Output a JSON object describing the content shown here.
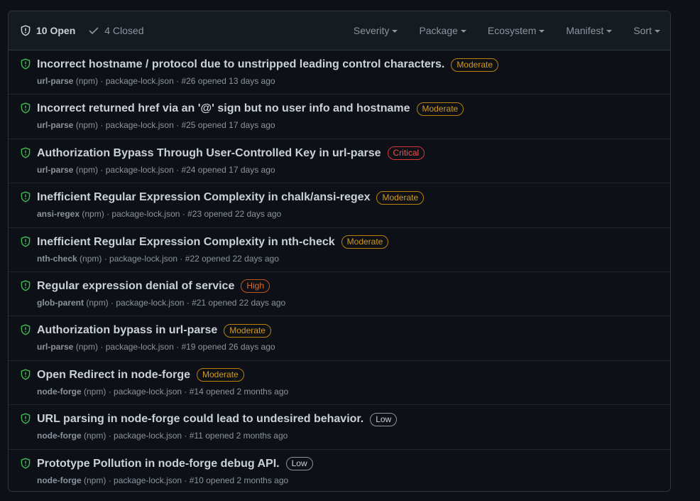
{
  "header": {
    "open_label": "10 Open",
    "closed_label": "4 Closed",
    "filters": [
      "Severity",
      "Package",
      "Ecosystem",
      "Manifest",
      "Sort"
    ]
  },
  "colors": {
    "shield_icon": "#3fb950",
    "moderate": "#d29922",
    "critical": "#f85149",
    "high": "#db6d28",
    "low": "#c9d1d9"
  },
  "alerts": [
    {
      "title": "Incorrect hostname / protocol due to unstripped leading control characters.",
      "severity": "Moderate",
      "severity_key": "moderate",
      "package": "url-parse",
      "ecosystem": "(npm)",
      "details": "· package-lock.json · #26 opened 13 days ago"
    },
    {
      "title": "Incorrect returned href via an '@' sign but no user info and hostname",
      "severity": "Moderate",
      "severity_key": "moderate",
      "package": "url-parse",
      "ecosystem": "(npm)",
      "details": "· package-lock.json · #25 opened 17 days ago"
    },
    {
      "title": "Authorization Bypass Through User-Controlled Key in url-parse",
      "severity": "Critical",
      "severity_key": "critical",
      "package": "url-parse",
      "ecosystem": "(npm)",
      "details": "· package-lock.json · #24 opened 17 days ago"
    },
    {
      "title": "Inefficient Regular Expression Complexity in chalk/ansi-regex",
      "severity": "Moderate",
      "severity_key": "moderate",
      "package": "ansi-regex",
      "ecosystem": "(npm)",
      "details": "· package-lock.json · #23 opened 22 days ago"
    },
    {
      "title": "Inefficient Regular Expression Complexity in nth-check",
      "severity": "Moderate",
      "severity_key": "moderate",
      "package": "nth-check",
      "ecosystem": "(npm)",
      "details": "· package-lock.json · #22 opened 22 days ago"
    },
    {
      "title": "Regular expression denial of service",
      "severity": "High",
      "severity_key": "high",
      "package": "glob-parent",
      "ecosystem": "(npm)",
      "details": "· package-lock.json · #21 opened 22 days ago"
    },
    {
      "title": "Authorization bypass in url-parse",
      "severity": "Moderate",
      "severity_key": "moderate",
      "package": "url-parse",
      "ecosystem": "(npm)",
      "details": "· package-lock.json · #19 opened 26 days ago"
    },
    {
      "title": "Open Redirect in node-forge",
      "severity": "Moderate",
      "severity_key": "moderate",
      "package": "node-forge",
      "ecosystem": "(npm)",
      "details": "· package-lock.json · #14 opened 2 months ago"
    },
    {
      "title": "URL parsing in node-forge could lead to undesired behavior.",
      "severity": "Low",
      "severity_key": "low",
      "package": "node-forge",
      "ecosystem": "(npm)",
      "details": "· package-lock.json · #11 opened 2 months ago"
    },
    {
      "title": "Prototype Pollution in node-forge debug API.",
      "severity": "Low",
      "severity_key": "low",
      "package": "node-forge",
      "ecosystem": "(npm)",
      "details": "· package-lock.json · #10 opened 2 months ago"
    }
  ]
}
